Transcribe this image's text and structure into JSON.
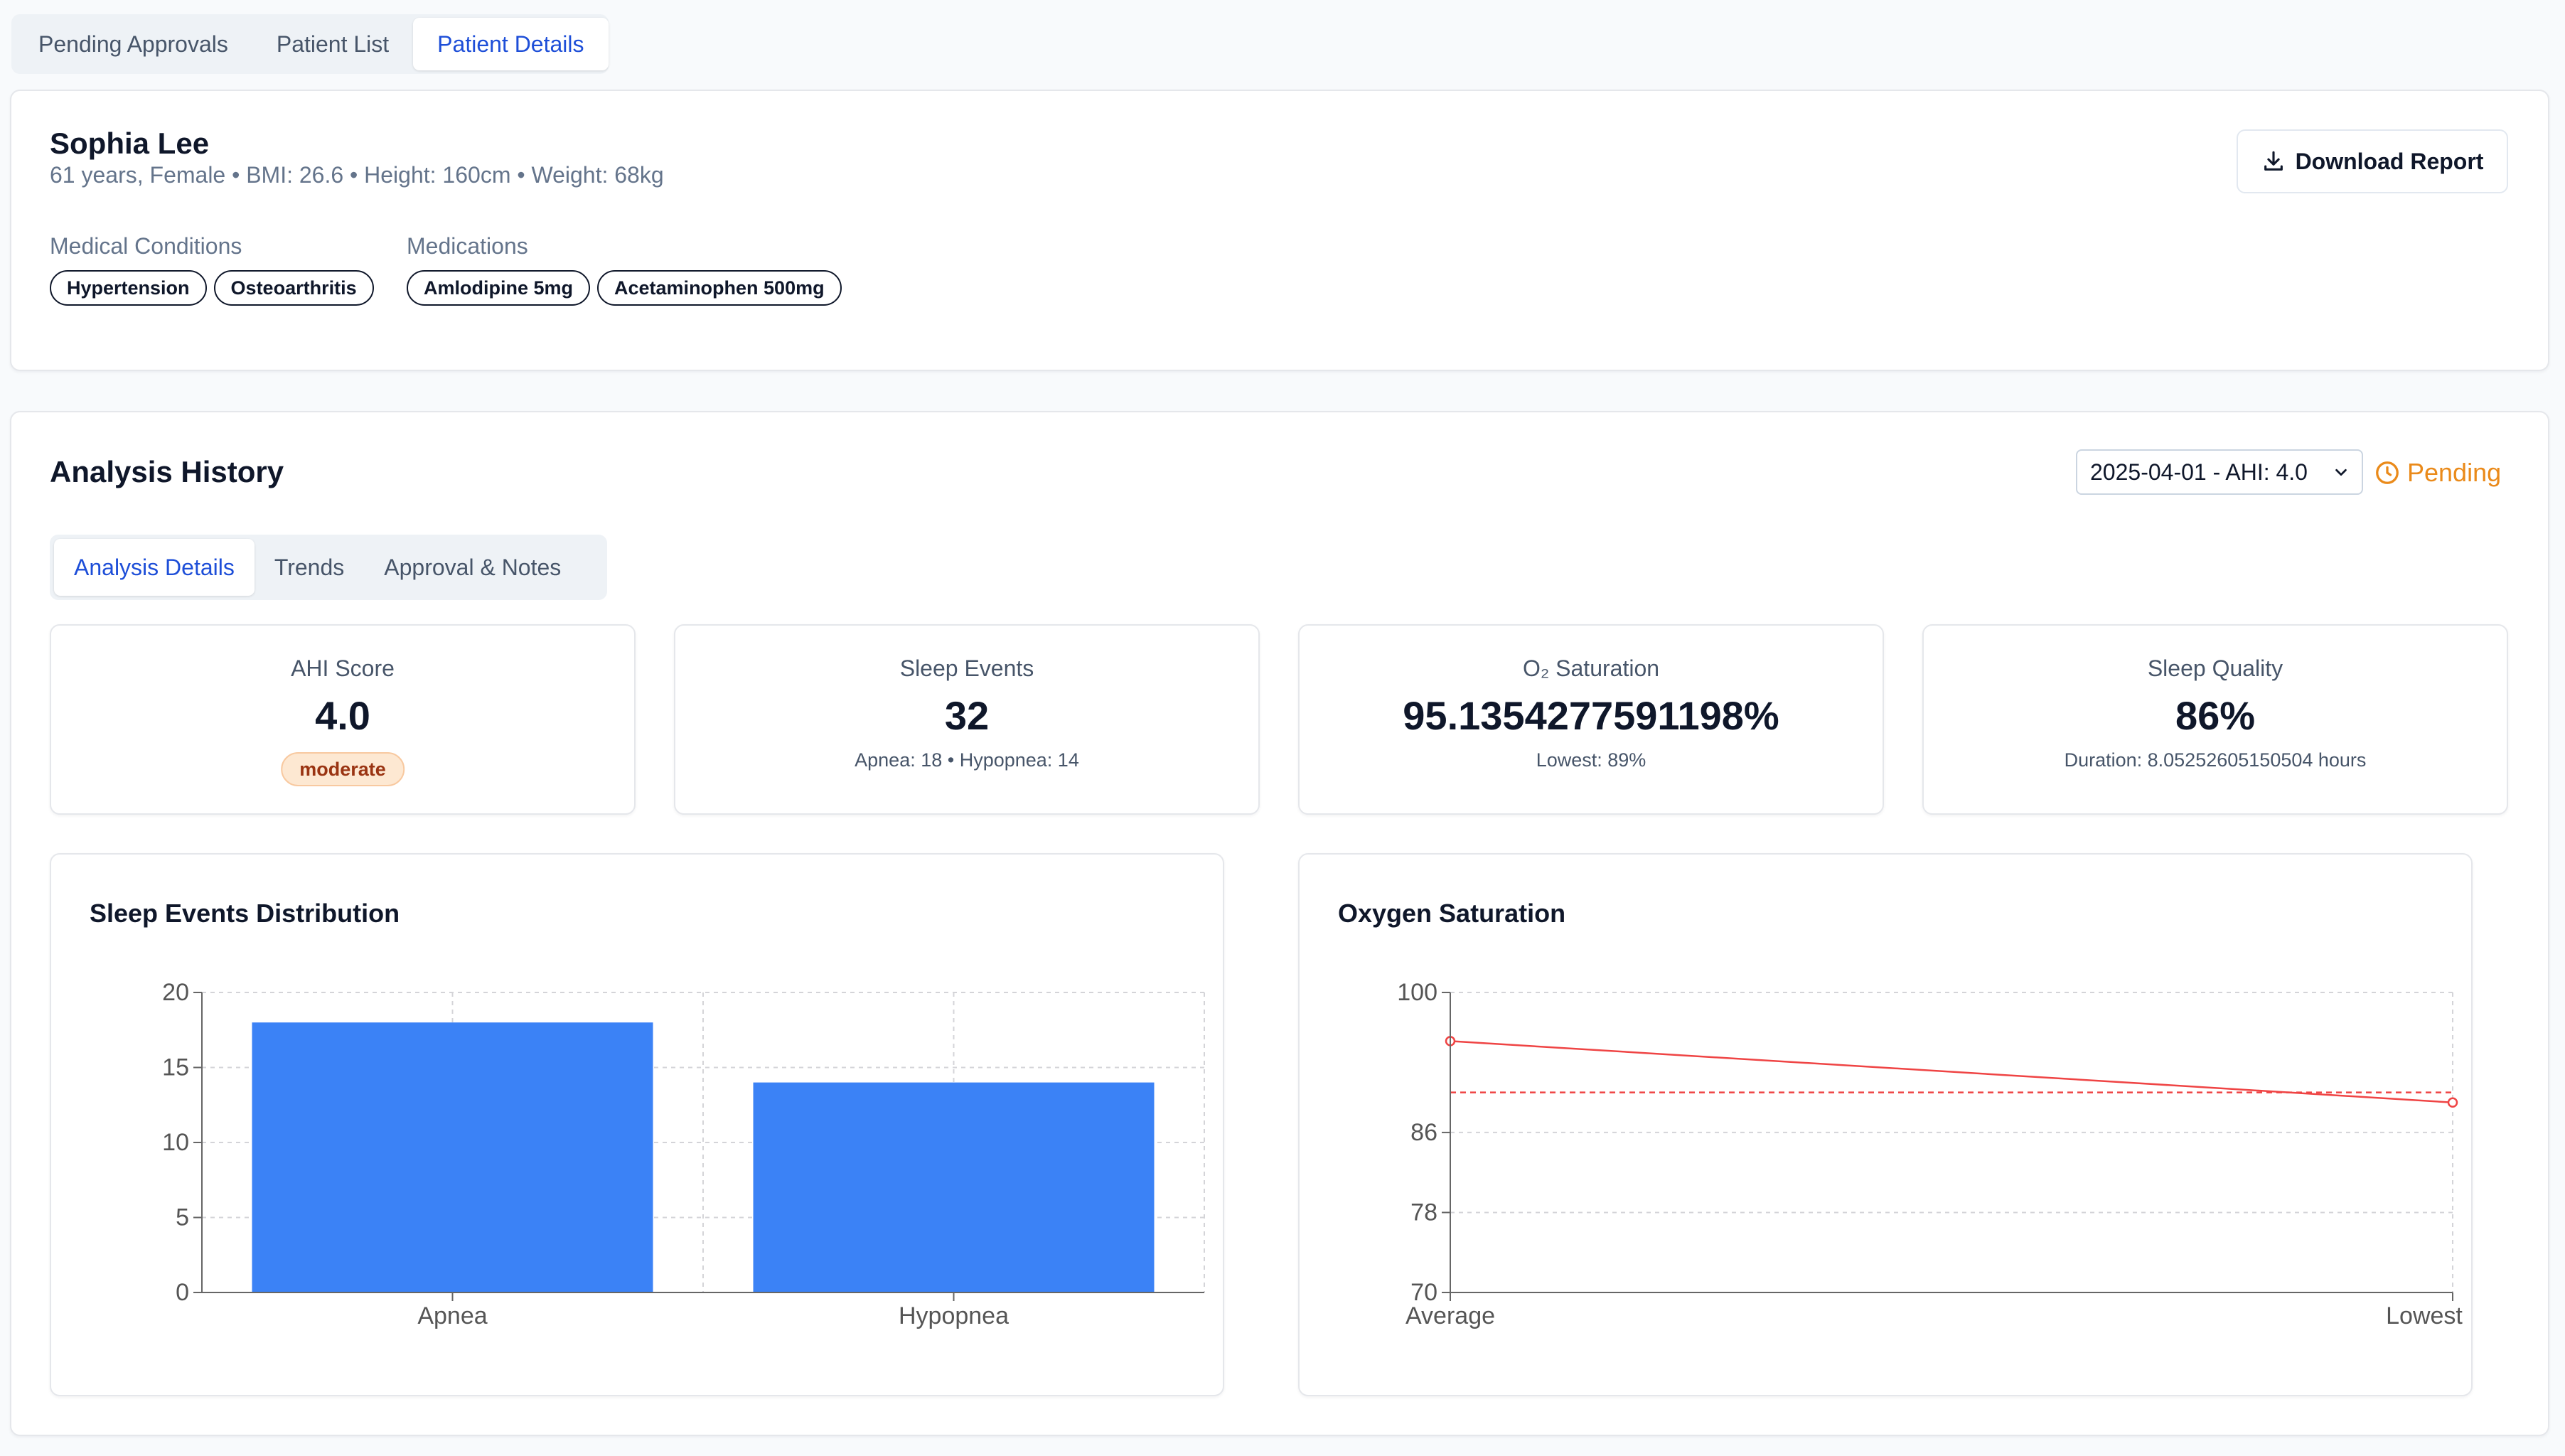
{
  "top_tabs": [
    {
      "label": "Pending Approvals",
      "active": false
    },
    {
      "label": "Patient List",
      "active": false
    },
    {
      "label": "Patient Details",
      "active": true
    }
  ],
  "patient": {
    "name": "Sophia Lee",
    "info": "61 years, Female • BMI: 26.6 • Height: 160cm • Weight: 68kg",
    "conditions_label": "Medical Conditions",
    "conditions": [
      "Hypertension",
      "Osteoarthritis"
    ],
    "medications_label": "Medications",
    "medications": [
      "Amlodipine 5mg",
      "Acetaminophen 500mg"
    ],
    "download_label": "Download Report"
  },
  "analysis": {
    "title": "Analysis History",
    "select_value": "2025-04-01 - AHI: 4.0",
    "status": "Pending",
    "tabs": [
      {
        "label": "Analysis Details",
        "active": true
      },
      {
        "label": "Trends",
        "active": false
      },
      {
        "label": "Approval & Notes",
        "active": false
      }
    ],
    "stats": {
      "ahi": {
        "label": "AHI Score",
        "value": "4.0",
        "badge": "moderate"
      },
      "events": {
        "label": "Sleep Events",
        "value": "32",
        "sub": "Apnea: 18 • Hypopnea: 14"
      },
      "o2": {
        "label": "O₂ Saturation",
        "value": "95.1354277591198%",
        "sub": "Lowest: 89%"
      },
      "quality": {
        "label": "Sleep Quality",
        "value": "86%",
        "sub": "Duration: 8.05252605150504 hours"
      }
    }
  },
  "colors": {
    "accent": "#1d4ed8",
    "bar": "#3b82f6",
    "line": "#ef4444",
    "pending": "#ea8a1a"
  },
  "chart_data": [
    {
      "type": "bar",
      "title": "Sleep Events Distribution",
      "categories": [
        "Apnea",
        "Hypopnea"
      ],
      "values": [
        18,
        14
      ],
      "ylim": [
        0,
        20
      ],
      "yticks": [
        0,
        5,
        10,
        15,
        20
      ],
      "grid": true
    },
    {
      "type": "line",
      "title": "Oxygen Saturation",
      "categories": [
        "Average",
        "Lowest"
      ],
      "values": [
        95.1354277591198,
        89
      ],
      "reference_line": 90,
      "ylim": [
        70,
        100
      ],
      "yticks": [
        70,
        78,
        86,
        100
      ],
      "grid": true
    }
  ]
}
